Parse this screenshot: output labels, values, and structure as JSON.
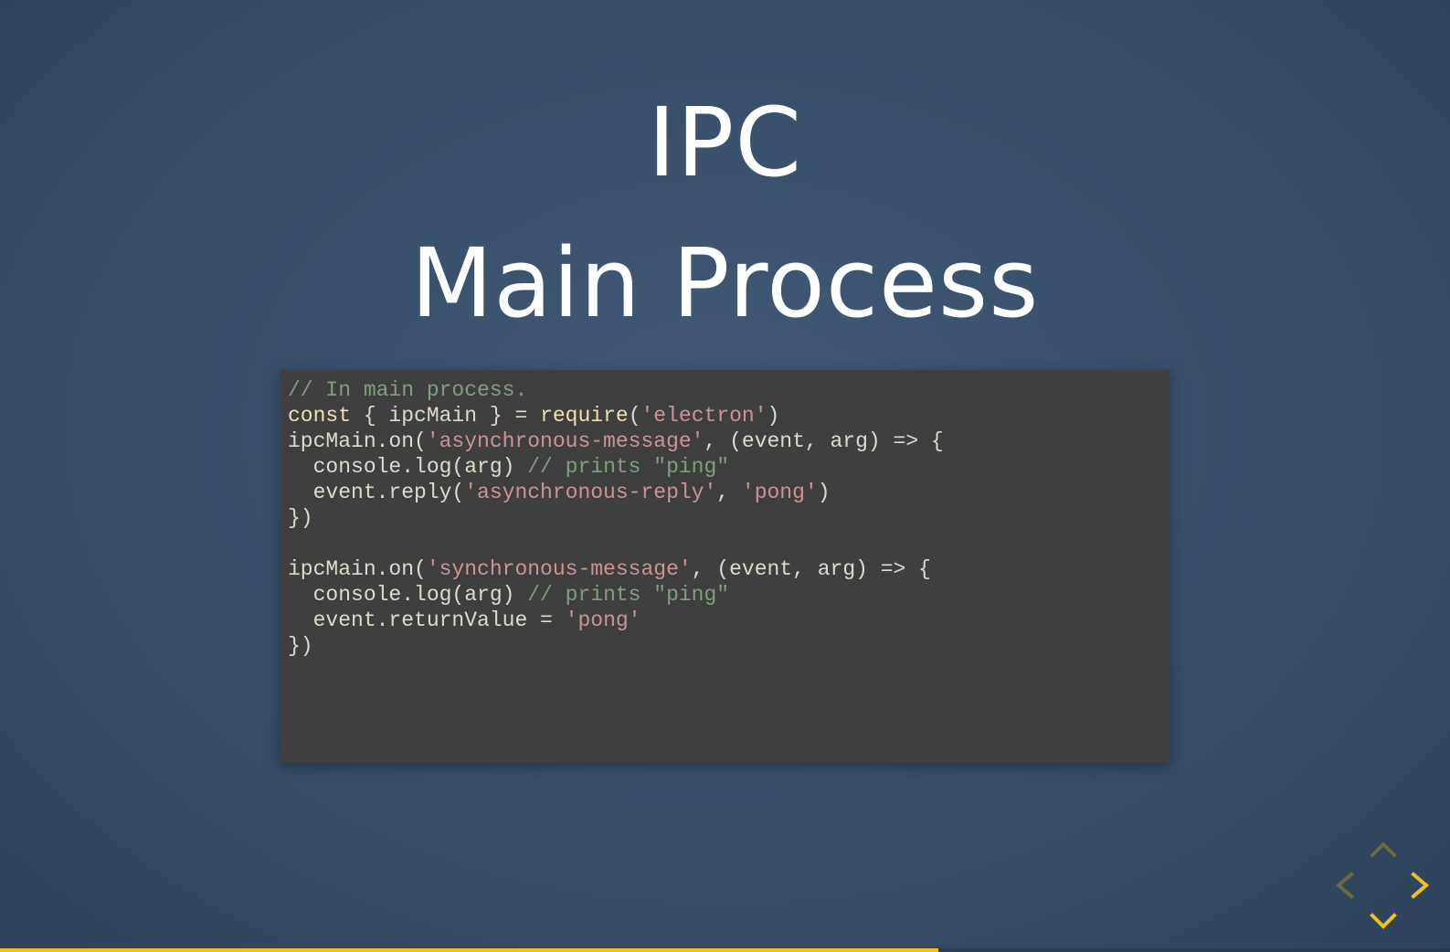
{
  "slide": {
    "title_line1": "IPC",
    "title_line2": "Main Process"
  },
  "code": {
    "lines": [
      [
        {
          "t": "comment",
          "v": "// In main process."
        }
      ],
      [
        {
          "t": "keyword",
          "v": "const"
        },
        {
          "t": "plain",
          "v": " { ipcMain } = "
        },
        {
          "t": "keyword",
          "v": "require"
        },
        {
          "t": "plain",
          "v": "("
        },
        {
          "t": "string",
          "v": "'electron'"
        },
        {
          "t": "plain",
          "v": ")"
        }
      ],
      [
        {
          "t": "plain",
          "v": "ipcMain.on("
        },
        {
          "t": "string",
          "v": "'asynchronous-message'"
        },
        {
          "t": "plain",
          "v": ", (event, arg) => {"
        }
      ],
      [
        {
          "t": "plain",
          "v": "  console.log(arg) "
        },
        {
          "t": "comment",
          "v": "// prints \"ping\""
        }
      ],
      [
        {
          "t": "plain",
          "v": "  event.reply("
        },
        {
          "t": "string",
          "v": "'asynchronous-reply'"
        },
        {
          "t": "plain",
          "v": ", "
        },
        {
          "t": "string",
          "v": "'pong'"
        },
        {
          "t": "plain",
          "v": ")"
        }
      ],
      [
        {
          "t": "plain",
          "v": "})"
        }
      ],
      [
        {
          "t": "plain",
          "v": ""
        }
      ],
      [
        {
          "t": "plain",
          "v": "ipcMain.on("
        },
        {
          "t": "string",
          "v": "'synchronous-message'"
        },
        {
          "t": "plain",
          "v": ", (event, arg) => {"
        }
      ],
      [
        {
          "t": "plain",
          "v": "  console.log(arg) "
        },
        {
          "t": "comment",
          "v": "// prints \"ping\""
        }
      ],
      [
        {
          "t": "plain",
          "v": "  event.returnValue = "
        },
        {
          "t": "string",
          "v": "'pong'"
        }
      ],
      [
        {
          "t": "plain",
          "v": "})"
        }
      ]
    ]
  },
  "navigation": {
    "up_icon": "chevron-up-icon",
    "down_icon": "chevron-down-icon",
    "left_icon": "chevron-left-icon",
    "right_icon": "chevron-right-icon",
    "active_color": "#f0c020",
    "inactive_color": "#6b6a3c"
  },
  "progress": {
    "fraction": 0.647,
    "color": "#f0c020"
  }
}
